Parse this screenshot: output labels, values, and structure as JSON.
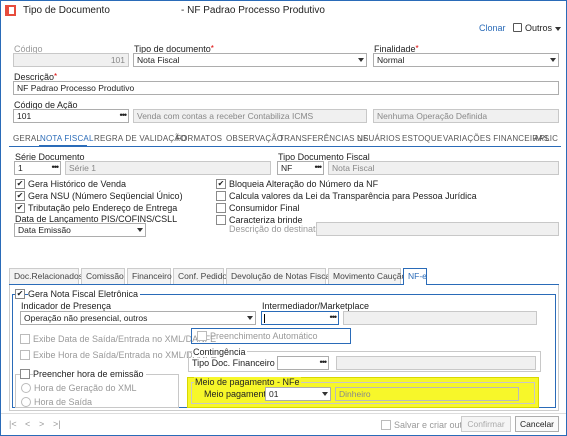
{
  "window": {
    "title": "Tipo de Documento",
    "subtitle": "- NF Padrao Processo Produtivo",
    "clone_label": "Clonar",
    "more_label": "Outros"
  },
  "header_form": {
    "codigo_label": "Código",
    "codigo_value": "101",
    "tipo_doc_label": "Tipo de documento",
    "tipo_doc_value": "Nota Fiscal",
    "finalidade_label": "Finalidade",
    "finalidade_value": "Normal",
    "descricao_label": "Descrição",
    "descricao_value": "NF Padrao Processo Produtivo",
    "codigo_acao_label": "Código de Ação",
    "codigo_acao_value": "101",
    "acao_desc": "Venda com contas a receber Contabiliza ICMS",
    "operacao_desc": "Nenhuma Operação Definida"
  },
  "tabs": [
    "GERAL",
    "NOTA FISCAL",
    "REGRA DE VALIDAÇÃO",
    "FORMATOS",
    "OBSERVAÇÃO",
    "TRANSFERÊNCIAS NF",
    "USUÁRIOS",
    "ESTOQUE",
    "VARIAÇÕES FINANCEIRAS",
    "APLIC"
  ],
  "nf": {
    "serie_label": "Série Documento",
    "serie_value": "1",
    "serie_desc": "Série 1",
    "tipo_fiscal_label": "Tipo Documento Fiscal",
    "tipo_fiscal_value": "NF",
    "tipo_fiscal_desc": "Nota Fiscal",
    "checks_left": [
      {
        "label": "Gera Histórico de Venda",
        "checked": true
      },
      {
        "label": "Gera NSU (Número Seqüencial Único)",
        "checked": true
      },
      {
        "label": "Tributação pelo Endereço de Entrega",
        "checked": true
      }
    ],
    "checks_right": [
      {
        "label": "Bloqueia Alteração do Número da NF",
        "checked": true
      },
      {
        "label": "Calcula valores da Lei da Transparência para Pessoa Jurídica",
        "checked": false
      },
      {
        "label": "Consumidor Final",
        "checked": false
      },
      {
        "label": "Caracteriza brinde",
        "checked": false
      }
    ],
    "data_lanc_label": "Data de Lançamento PIS/COFINS/CSLL",
    "data_lanc_value": "Data Emissão",
    "destinatario_label": "Descrição do destinatário"
  },
  "subtabs": [
    "Doc.Relacionados",
    "Comissão",
    "Financeiro",
    "Conf. Pedido",
    "Devolução de Notas Fiscais",
    "Movimento Caução",
    "NF-e"
  ],
  "nfe": {
    "gera_label": "Gera Nota Fiscal Eletrônica",
    "indicador_label": "Indicador de Presença",
    "indicador_value": "Operação não presencial, outros",
    "intermediador_label": "Intermediador/Marketplace",
    "exibe_data_label": "Exibe Data de Saída/Entrada no XML/DANFE",
    "exibe_hora_label": "Exibe Hora de Saída/Entrada no XML/DANFE",
    "preench_auto_label": "Preenchimento Automático",
    "contingencia_label": "Contingência",
    "tipo_doc_fin_label": "Tipo Doc. Financeiro",
    "preencher_hora_label": "Preencher hora de emissão",
    "hora_geracao_label": "Hora de Geração do XML",
    "hora_saida_label": "Hora de Saída",
    "meio_group_label": "Meio de pagamento - NFe",
    "meio_label": "Meio pagamento",
    "meio_value": "01",
    "meio_desc": "Dinheiro"
  },
  "footer": {
    "salvar_criar_label": "Salvar e criar outro",
    "confirmar_label": "Confirmar",
    "cancelar_label": "Cancelar"
  },
  "colors": {
    "accent": "#2a6bb8",
    "highlight": "#f7f72a"
  }
}
